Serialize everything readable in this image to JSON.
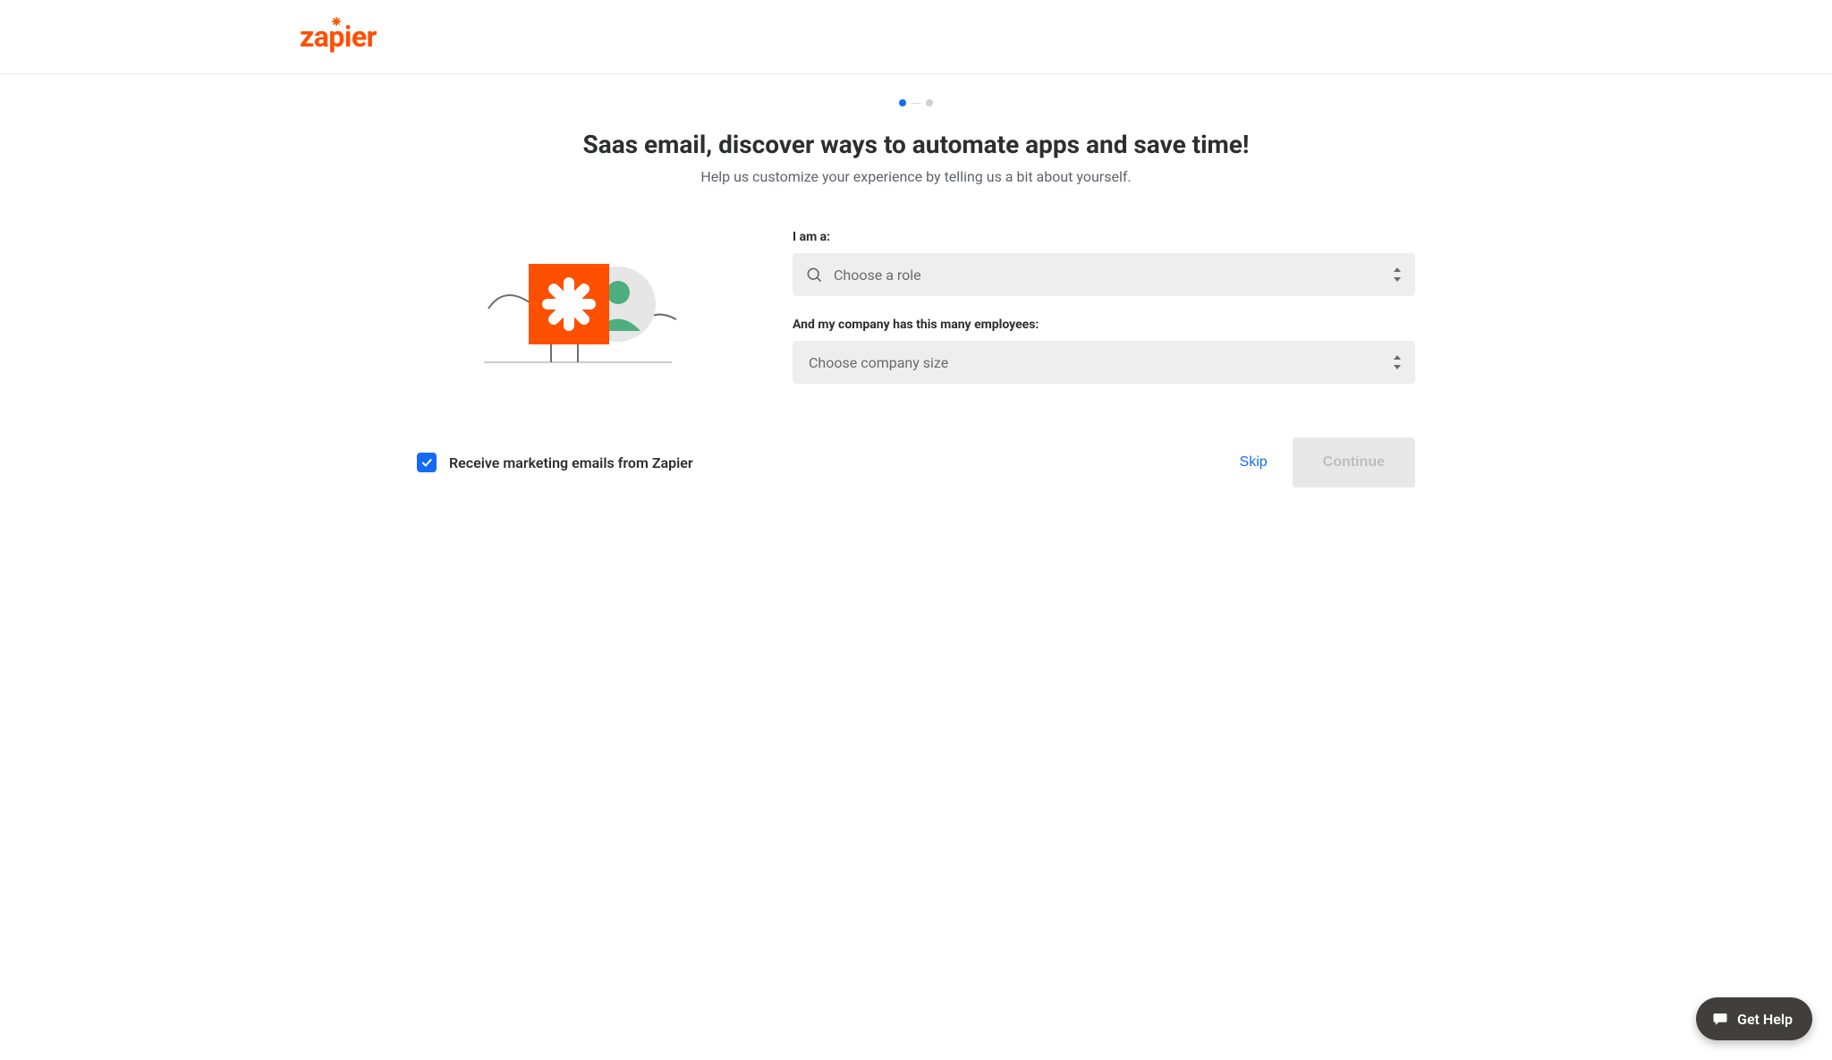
{
  "brand": {
    "name": "zapier",
    "color": "#ff4f00"
  },
  "progress": {
    "current": 1,
    "total": 2
  },
  "headline": {
    "title": "Saas email, discover ways to automate apps and save time!",
    "subtitle": "Help us customize your experience by telling us a bit about yourself."
  },
  "form": {
    "role": {
      "label": "I am a:",
      "placeholder": "Choose a role"
    },
    "company_size": {
      "label": "And my company has this many employees:",
      "placeholder": "Choose company size"
    }
  },
  "marketing_checkbox": {
    "checked": true,
    "label": "Receive marketing emails from Zapier"
  },
  "actions": {
    "skip": "Skip",
    "continue": "Continue"
  },
  "help_widget": {
    "label": "Get Help"
  }
}
